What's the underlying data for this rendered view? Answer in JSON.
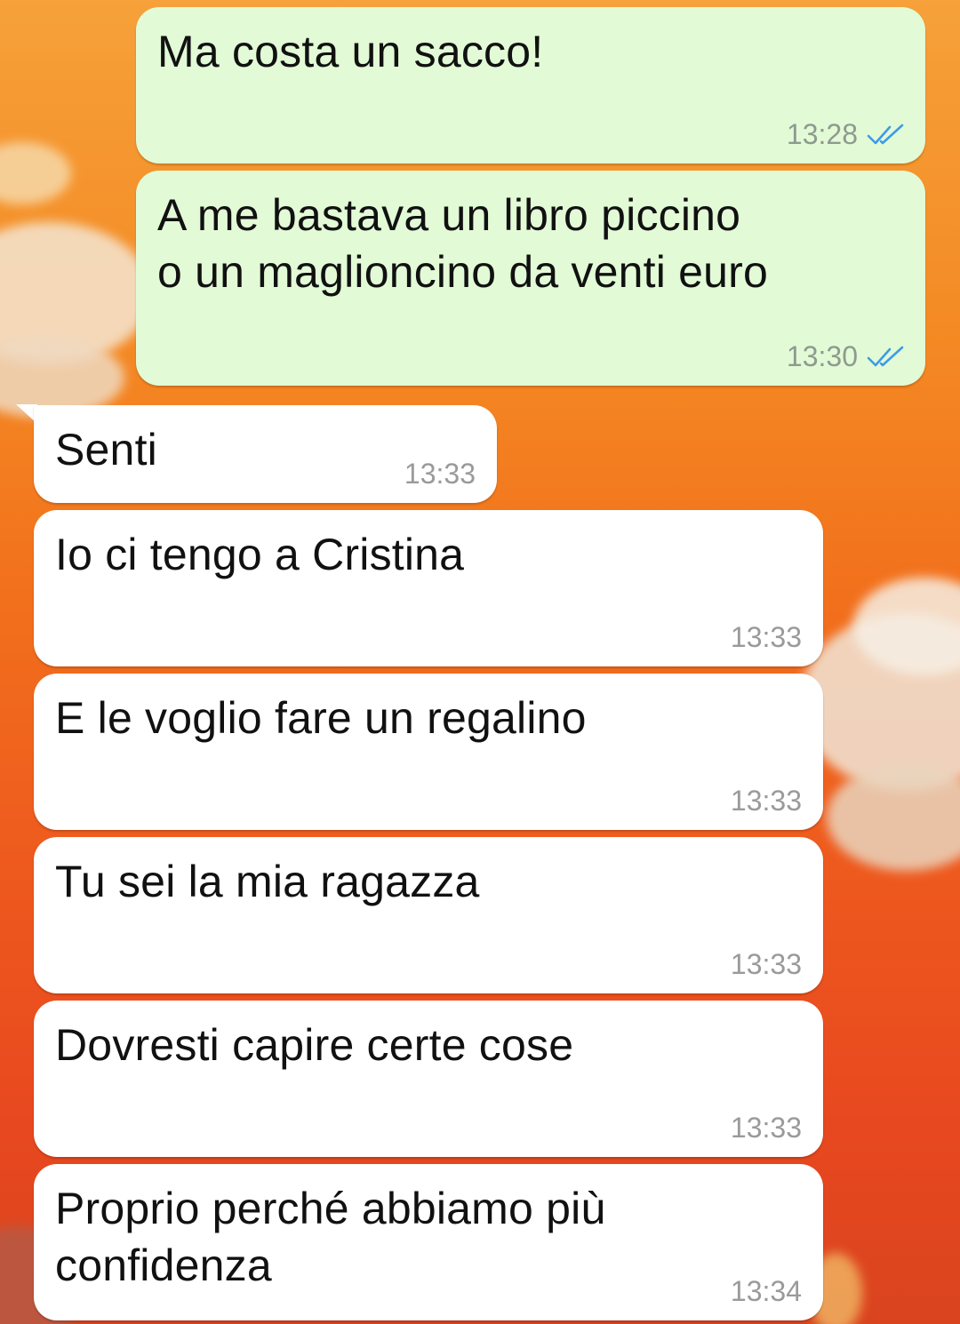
{
  "theme": {
    "outgoing_bubble": "#e2fbd6",
    "incoming_bubble": "#ffffff",
    "read_ticks": "#3d9be8"
  },
  "messages": [
    {
      "direction": "out",
      "text": "Ma costa un sacco!",
      "time": "13:28",
      "status": "read"
    },
    {
      "direction": "out",
      "text": "A me bastava un libro piccino\no un maglioncino da venti euro",
      "time": "13:30",
      "status": "read"
    },
    {
      "direction": "in",
      "text": "Senti",
      "time": "13:33"
    },
    {
      "direction": "in",
      "text": "Io ci tengo a Cristina",
      "time": "13:33"
    },
    {
      "direction": "in",
      "text": "E le voglio fare un regalino",
      "time": "13:33"
    },
    {
      "direction": "in",
      "text": "Tu sei la mia ragazza",
      "time": "13:33"
    },
    {
      "direction": "in",
      "text": "Dovresti capire certe cose",
      "time": "13:33"
    },
    {
      "direction": "in",
      "text": "Proprio perché abbiamo più\nconfidenza",
      "time": "13:34"
    }
  ]
}
